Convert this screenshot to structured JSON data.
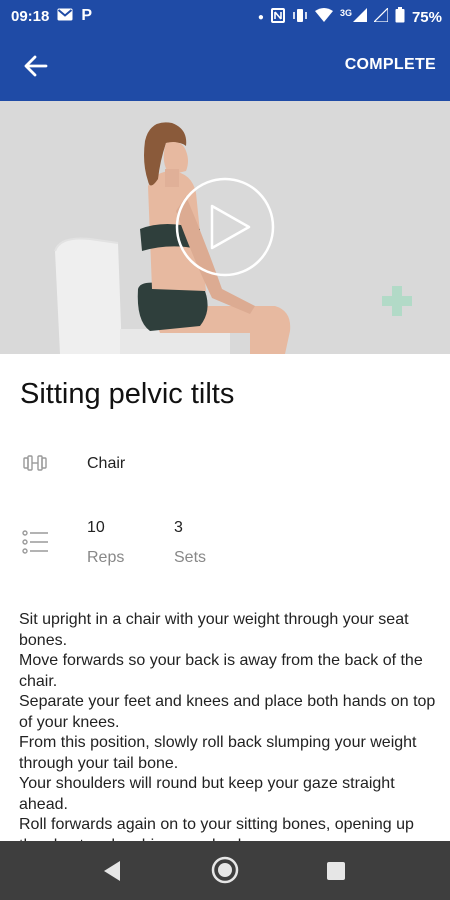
{
  "status_bar": {
    "time": "09:18",
    "battery": "75%",
    "network": "3G"
  },
  "toolbar": {
    "complete_label": "COMPLETE"
  },
  "exercise": {
    "title": "Sitting pelvic tilts",
    "equipment": "Chair",
    "reps_value": "10",
    "reps_label": "Reps",
    "sets_value": "3",
    "sets_label": "Sets",
    "description": [
      "Sit upright in a chair with your weight through your seat bones.",
      "Move forwards so your back is away from the back of the chair.",
      "Separate your feet and knees and place both hands on top of your knees.",
      "From this position, slowly roll back slumping your weight through your tail bone.",
      "Your shoulders will round but keep your gaze straight ahead.",
      "Roll forwards again on to your sitting bones, opening up the chest and arching your back."
    ]
  },
  "colors": {
    "app_bar": "#1f4ba6",
    "nav_bar": "#3e3e3e",
    "video_bg": "#d9d9d9"
  }
}
